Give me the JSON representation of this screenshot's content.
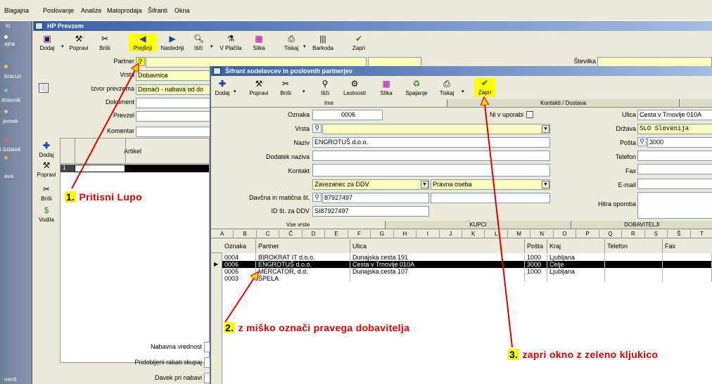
{
  "menu": [
    "Blagajna",
    "Poslovanje",
    "Analize",
    "Maloprodaja",
    "Šifranti",
    "Okna"
  ],
  "left_strip": [
    "lo",
    "ajna",
    "bracun",
    "dnevnik",
    "jemek",
    "i izdatek",
    "ava",
    "nenti"
  ],
  "hp_window": {
    "title": "HP Prevzem",
    "toolbar": [
      "Dodaj",
      "Popravi",
      "Briši",
      "Prejšnji",
      "Naslednji",
      "Išči",
      "V Plačila",
      "Slika",
      "Tiskaj",
      "Barkoda",
      "Zapri"
    ],
    "form": {
      "partner_label": "Partner",
      "vrsta_label": "Vrsta",
      "vrsta_value": "Dobavnica",
      "izvor_label": "Izvor prevzema",
      "izvor_value": "Domači - nabava od do",
      "dokument_label": "Dokument",
      "prevzel_label": "Prevzel",
      "komentar_label": "Komentar",
      "stevilka_label": "Številka"
    },
    "side_buttons": [
      "Dodaj",
      "Popravi",
      "Briši",
      "Vodila"
    ],
    "grid_header": "Artikel",
    "grid_row_num": "1",
    "footer": [
      "Nabavna vrednost",
      "Pridobljeni rabati skupaj",
      "Davek pri nabavi"
    ]
  },
  "sifrant_window": {
    "title": "Šifrant sodelavcev in poslovnih partnerjev",
    "toolbar": [
      "Dodaj",
      "Popravi",
      "Briši",
      "Išči",
      "Lastnosti",
      "Slika",
      "Spajanje",
      "Tiskaj",
      "Zapri"
    ],
    "tabs_top": [
      "Ime",
      "Kontakti / Dostava"
    ],
    "form": {
      "oznaka_label": "Oznaka",
      "oznaka_value": "0006",
      "ni_v_uporabi_label": "Ni v uporabi",
      "vrsta_label": "Vrsta",
      "naziv_label": "Naziv",
      "naziv_value": "ENGROTUŠ d.o.o.",
      "dodatek_label": "Dodatek naziva",
      "kontakt_label": "Kontakt",
      "zavezanec_value": "Zavezanec za DDV",
      "pravna_value": "Pravna oseba",
      "davcna_label": "Davčna in matična št.",
      "davcna_value": "87927497",
      "id_ddv_label": "ID št. za DDV",
      "id_ddv_value": "SI87927497",
      "ulica_label": "Ulica",
      "ulica_value": "Cesta v Trnovlje 010A",
      "drzava_label": "Država",
      "drzava_value": "SLO  Slovenija",
      "posta_label": "Pošta",
      "posta_value": "3000",
      "telefon_label": "Telefon",
      "fax_label": "Fax",
      "email_label": "E-mail",
      "hitra_label": "Hitra opomba"
    },
    "tabs_mid": [
      "Vse vrste",
      "KUPCI",
      "DOBAVITELJI"
    ],
    "alpha": [
      "A",
      "B",
      "C",
      "Č",
      "D",
      "E",
      "F",
      "G",
      "H",
      "I",
      "J",
      "K",
      "L",
      "M",
      "N",
      "O",
      "P",
      "Q",
      "R",
      "S",
      "Š",
      "T"
    ],
    "grid_columns": [
      "Oznaka",
      "Partner",
      "Ulica",
      "Pošta",
      "Kraj",
      "Telefon",
      "Fax"
    ],
    "rows": [
      {
        "oznaka": "0004",
        "partner": "BIROKRAT IT d.o.o.",
        "ulica": "Dunajska cesta 191",
        "posta": "1000",
        "kraj": "Ljubljana"
      },
      {
        "oznaka": "0006",
        "partner": "ENGROTUŠ d.o.o.",
        "ulica": "Cesta v Trnovlje 010A",
        "posta": "3000",
        "kraj": "Celje"
      },
      {
        "oznaka": "0005",
        "partner": "MERCATOR, d.d.",
        "ulica": "Dunajska cesta 107",
        "posta": "1000",
        "kraj": "Ljubljana"
      },
      {
        "oznaka": "0003",
        "partner": "ŠPELA",
        "ulica": "",
        "posta": "",
        "kraj": ""
      }
    ]
  },
  "annotations": {
    "a1_num": "1.",
    "a1_text": "Pritisni Lupo",
    "a2_num": "2.",
    "a2_text": "z miško označi pravega dobavitelja",
    "a3_num": "3.",
    "a3_text": "zapri okno z zeleno kljukico"
  },
  "colors": {
    "highlight": "#ffff00",
    "annotation_red": "#e00000",
    "title_blue": "#3a5fa6",
    "field_yellow": "#ffffc0"
  }
}
